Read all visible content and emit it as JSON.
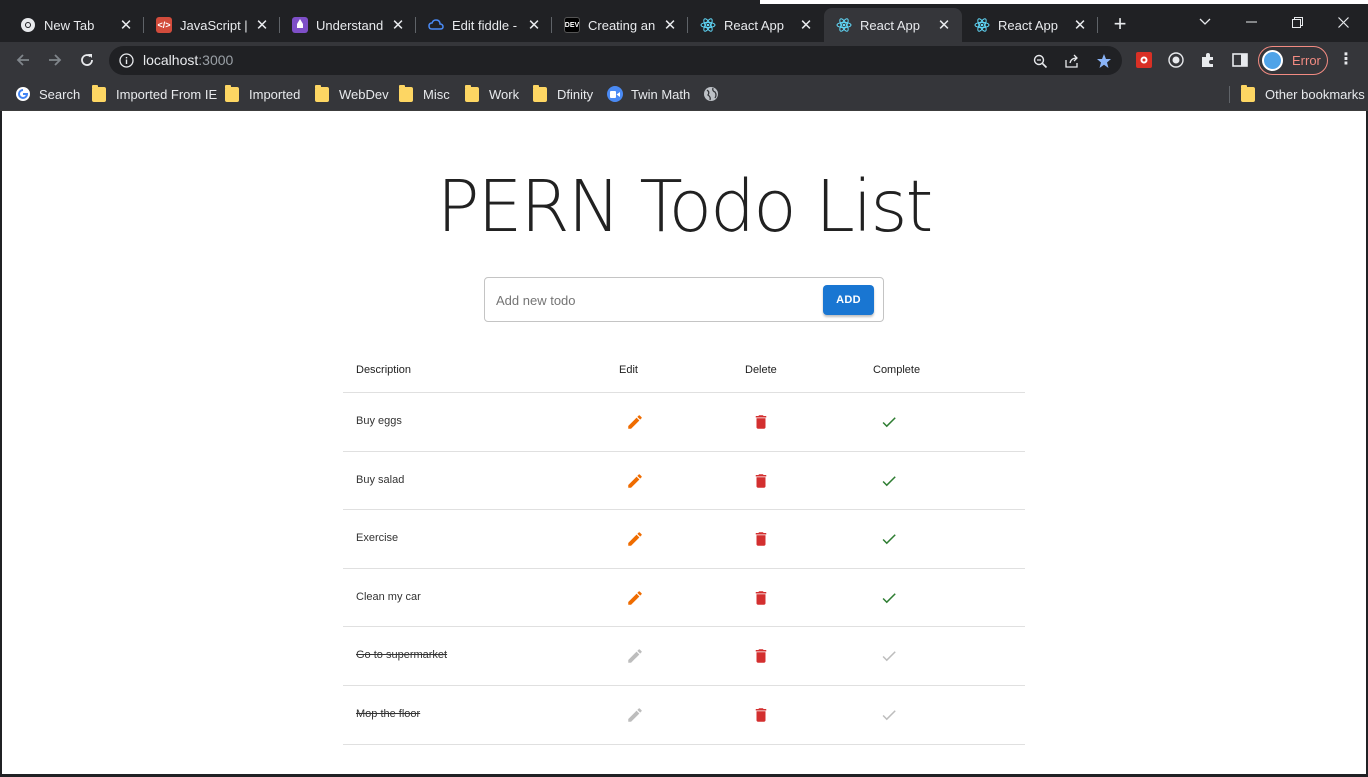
{
  "browser": {
    "tabs": [
      {
        "title": "New Tab",
        "favicon": "chrome-icon",
        "color": "#e8eaed"
      },
      {
        "title": "JavaScript | C",
        "favicon": "code-icon",
        "color": "#d24c3c"
      },
      {
        "title": "Understandin",
        "favicon": "rocket-icon",
        "color": "#7e4fc8"
      },
      {
        "title": "Edit fiddle - J",
        "favicon": "cloud-icon",
        "color": "#4a8af4"
      },
      {
        "title": "Creating an A",
        "favicon": "dev-icon",
        "color": "#000000"
      },
      {
        "title": "React App",
        "favicon": "react-icon",
        "color": "#61dafb"
      },
      {
        "title": "React App",
        "favicon": "react-icon",
        "color": "#61dafb",
        "active": true
      },
      {
        "title": "React App",
        "favicon": "react-icon",
        "color": "#61dafb"
      }
    ],
    "close_glyph": "✕",
    "new_tab_glyph": "+",
    "url_host": "localhost",
    "url_port": ":3000",
    "profile_label": "Error",
    "bookmarks": [
      {
        "label": "Search",
        "icon": "google-icon"
      },
      {
        "label": "Imported From IE",
        "icon": "folder-icon"
      },
      {
        "label": "Imported",
        "icon": "folder-icon"
      },
      {
        "label": "WebDev",
        "icon": "folder-icon"
      },
      {
        "label": "Misc",
        "icon": "folder-icon"
      },
      {
        "label": "Work",
        "icon": "folder-icon"
      },
      {
        "label": "Dfinity",
        "icon": "folder-icon"
      },
      {
        "label": "Twin Math",
        "icon": "zoom-icon"
      },
      {
        "label": "",
        "icon": "globe-icon"
      }
    ],
    "other_bookmarks": "Other bookmarks"
  },
  "app": {
    "title": "PERN Todo List",
    "input_placeholder": "Add new todo",
    "add_label": "ADD",
    "columns": {
      "description": "Description",
      "edit": "Edit",
      "delete": "Delete",
      "complete": "Complete"
    },
    "todos": [
      {
        "description": "Buy eggs",
        "completed": false
      },
      {
        "description": "Buy salad",
        "completed": false
      },
      {
        "description": "Exercise",
        "completed": false
      },
      {
        "description": "Clean my car",
        "completed": false
      },
      {
        "description": "Go to supermarket",
        "completed": true
      },
      {
        "description": "Mop the floor",
        "completed": true
      }
    ],
    "colors": {
      "edit": "#ef6c00",
      "delete": "#d32f2f",
      "complete": "#2e7d32",
      "disabled": "#bdbdbd",
      "primary": "#1976d2"
    }
  }
}
